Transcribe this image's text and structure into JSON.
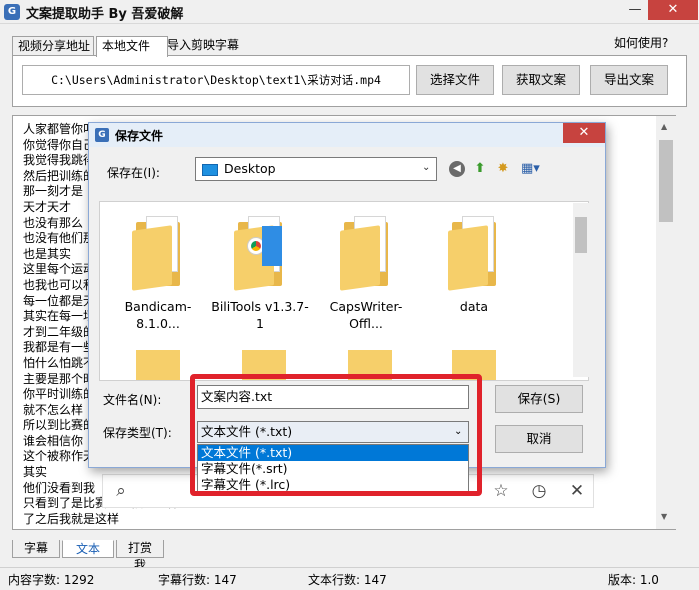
{
  "window": {
    "title": "文案提取助手 By 吾爱破解",
    "icon_label": "G"
  },
  "top_tabs": [
    {
      "label": "视频分享地址"
    },
    {
      "label": "本地文件"
    },
    {
      "label": "导入剪映字幕"
    }
  ],
  "help_label": "如何使用?",
  "file_path": "C:\\Users\\Administrator\\Desktop\\text1\\采访对话.mp4",
  "buttons": {
    "choose_file": "选择文件",
    "get_copy": "获取文案",
    "export_copy": "导出文案"
  },
  "text_lines": [
    "人家都管你叫",
    "你觉得你自己",
    "我觉得我跳得",
    "然后把训练的",
    "那一刻才是",
    "天才天才",
    "也没有那么",
    "也没有他们那",
    "也是其实",
    "这里每个运动",
    "也我也可以和",
    "每一位都是无",
    "其实在每一场",
    "才到二年级的",
    "我都是有一些",
    "怕什么怕跳不",
    "主要是那个时",
    "你平时训练的",
    "就不怎么样",
    "所以到比赛的",
    "谁会相信你",
    "这个被称作天",
    "其实",
    "他们没看到我",
    "只看到了是比赛的时候怎么样",
    "了之后我就是这样"
  ],
  "bottom_tabs": [
    {
      "label": "字幕"
    },
    {
      "label": "文本"
    },
    {
      "label": "打赏我"
    }
  ],
  "status": {
    "content_chars": "内容字数: 1292",
    "subtitle_lines": "字幕行数: 147",
    "text_lines": "文本行数: 147",
    "version": "版本: 1.0"
  },
  "dialog": {
    "title": "保存文件",
    "look_in_label": "保存在(I):",
    "look_in_value": "Desktop",
    "files": [
      {
        "name": "Bandicam-8.1.0..."
      },
      {
        "name": "BiliTools v1.3.7-1"
      },
      {
        "name": "CapsWriter-Offl..."
      },
      {
        "name": "data"
      }
    ],
    "filename_label": "文件名(N):",
    "filename_value": "文案内容.txt",
    "filetype_label": "保存类型(T):",
    "filetype_value": "文本文件 (*.txt)",
    "filetype_options": [
      {
        "label": "文本文件 (*.txt)"
      },
      {
        "label": "字幕文件(*.srt)"
      },
      {
        "label": "字幕文件 (*.lrc)"
      }
    ],
    "save_button": "保存(S)",
    "cancel_button": "取消"
  }
}
